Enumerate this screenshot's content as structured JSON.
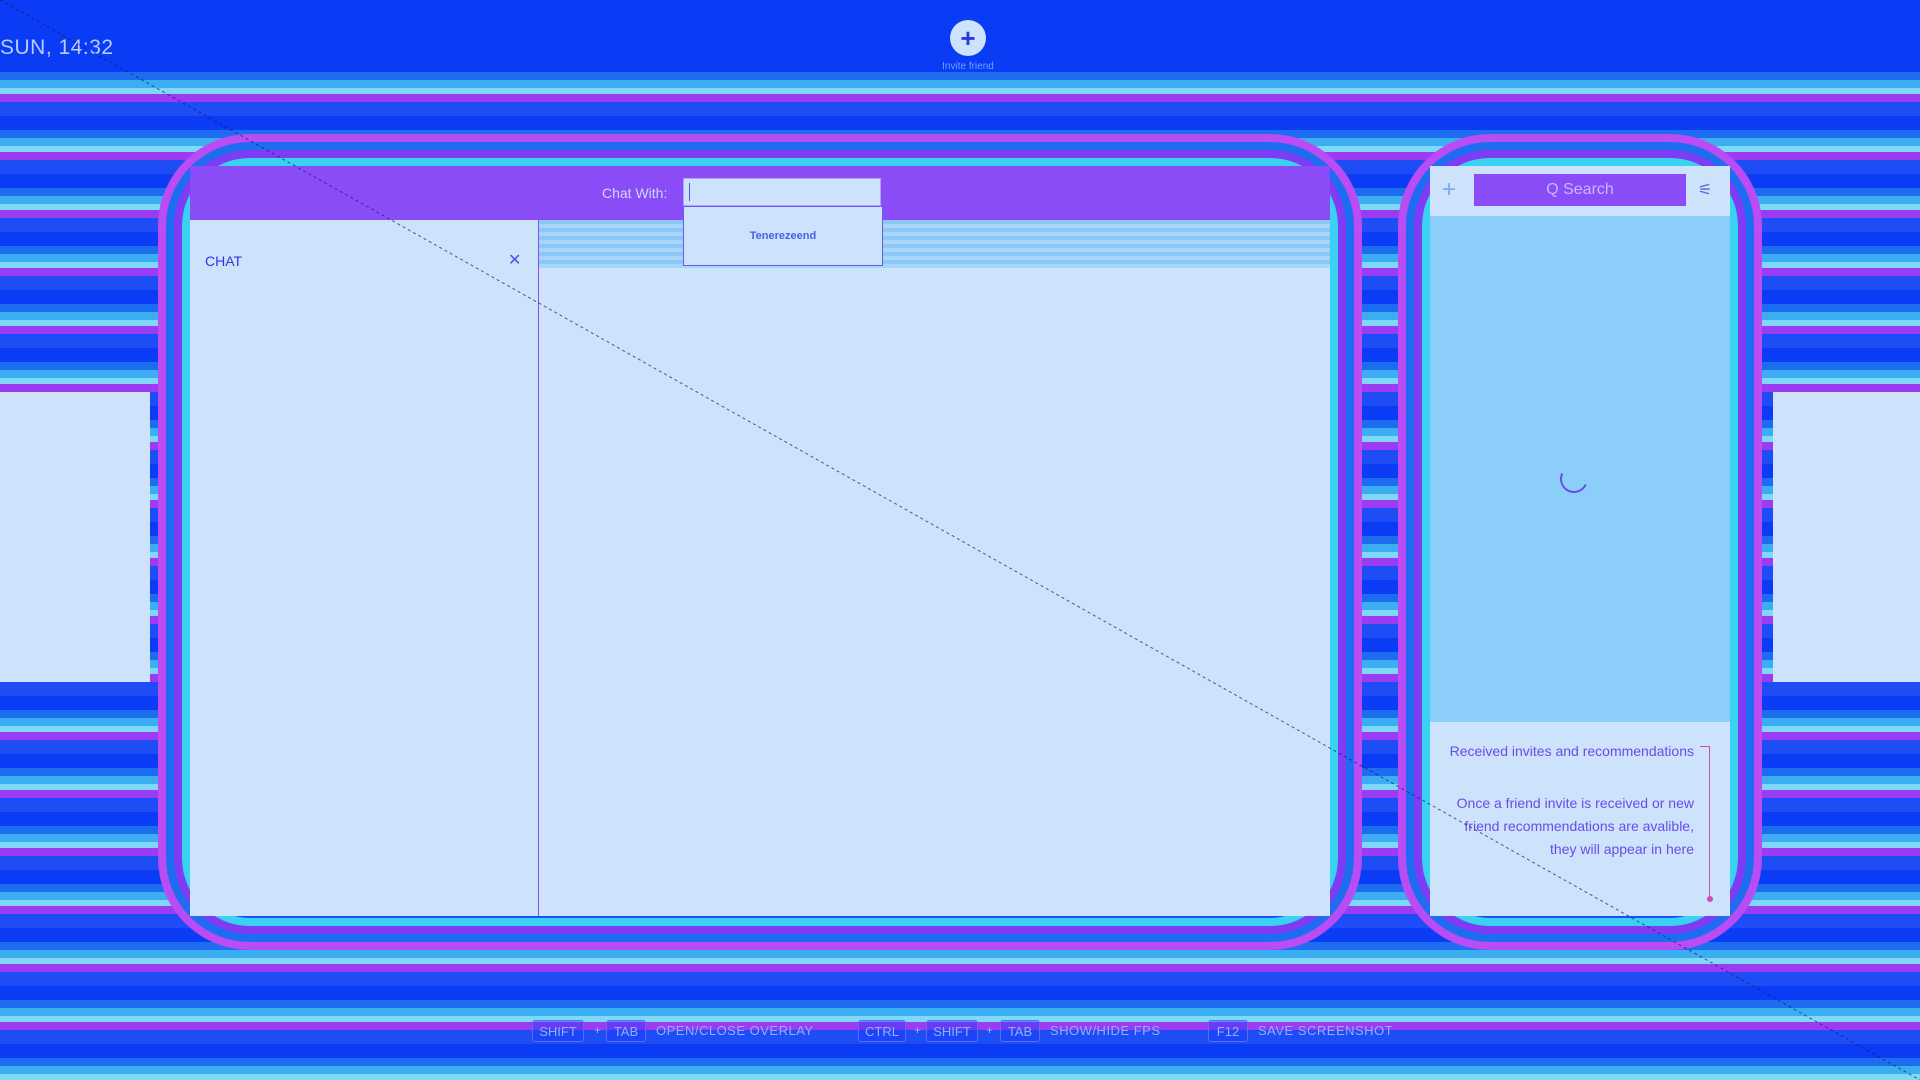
{
  "clock": "SUN, 14:32",
  "top_button": {
    "icon": "plus-icon",
    "label": "Invite friend"
  },
  "chat": {
    "chat_with_label": "Chat With:",
    "chat_with_value": "",
    "dropdown_item": "Tenerezeend",
    "left_pane_title": "CHAT",
    "close_icon": "close-icon"
  },
  "friends": {
    "add_icon": "plus-icon",
    "search_placeholder": "Q  Search",
    "filter_icon": "sliders-icon",
    "invites_title": "Received invites and recommendations",
    "invites_body": "Once a friend invite is received or new friend recommendations are avalible, they will appear in here"
  },
  "hints": [
    {
      "keys": [
        "SHIFT",
        "TAB"
      ],
      "label": "OPEN/CLOSE OVERLAY"
    },
    {
      "keys": [
        "CTRL",
        "SHIFT",
        "TAB"
      ],
      "label": "SHOW/HIDE FPS"
    },
    {
      "keys": [
        "F12"
      ],
      "label": "SAVE SCREENSHOT"
    }
  ],
  "plus_sep": "+",
  "colors": {
    "header": "#8a4cf7",
    "panel": "#cde2fb",
    "friends_body": "#8ccefa",
    "background": "#0a3cf5"
  }
}
